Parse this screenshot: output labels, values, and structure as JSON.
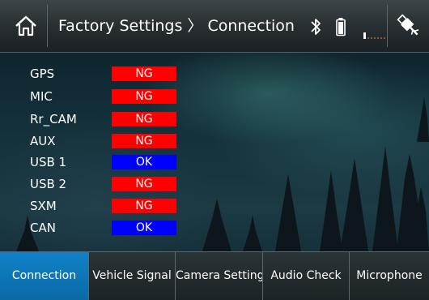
{
  "header": {
    "title": "Factory Settings 〉 Connection",
    "home_icon": "home-icon",
    "bluetooth_icon": "bluetooth-icon",
    "battery_icon": "battery-icon",
    "signal_icon": "signal-strength-icon",
    "usb_icon": "usb-icon"
  },
  "connection_status": [
    {
      "name": "GPS",
      "status": "NG"
    },
    {
      "name": "MIC",
      "status": "NG"
    },
    {
      "name": "Rr_CAM",
      "status": "NG"
    },
    {
      "name": "AUX",
      "status": "NG"
    },
    {
      "name": "USB 1",
      "status": "OK"
    },
    {
      "name": "USB 2",
      "status": "NG"
    },
    {
      "name": "SXM",
      "status": "NG"
    },
    {
      "name": "CAN",
      "status": "OK"
    }
  ],
  "tabs": [
    {
      "label": "Connection",
      "active": true
    },
    {
      "label": "Vehicle Signal",
      "active": false
    },
    {
      "label": "Camera Setting",
      "active": false
    },
    {
      "label": "Audio Check",
      "active": false
    },
    {
      "label": "Microphone",
      "active": false
    }
  ],
  "colors": {
    "ng": "#ff0000",
    "ok": "#0000ff",
    "active_tab": "#0f82c8"
  }
}
